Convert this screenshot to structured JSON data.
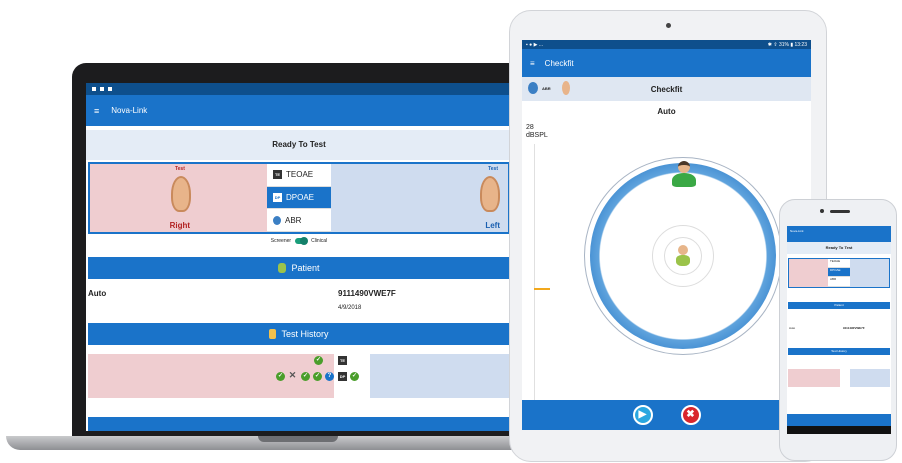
{
  "laptop": {
    "app_title": "Nova-Link",
    "menu_icon": "≡",
    "banner": "Ready To Test",
    "right_ear": {
      "test_label": "Test",
      "side_label": "Right"
    },
    "left_ear": {
      "test_label": "Test",
      "side_label": "Left"
    },
    "tests": [
      {
        "badge": "TE",
        "label": "TEOAE",
        "selected": false
      },
      {
        "badge": "DP",
        "label": "DPOAE",
        "selected": true
      },
      {
        "badge": "",
        "label": "ABR",
        "selected": false
      }
    ],
    "mode": {
      "left": "Screener",
      "right": "Clinical",
      "clinical_on": true
    },
    "patient_section": "Patient",
    "patient": {
      "name": "Auto",
      "id": "9111490VWE7F",
      "date": "4/9/2018"
    },
    "history_section": "Test History",
    "history_badges": [
      "TE",
      "DP"
    ]
  },
  "tablet": {
    "app_title": "Checkfit",
    "menu_icon": "≡",
    "status_right": "✱ ⇧ 31% ▮ 13:23",
    "header_abr": "ABR",
    "header_title": "Checkfit",
    "mode_label": "Auto",
    "level_value": "28",
    "level_unit": "dBSPL",
    "play_symbol": "▶",
    "stop_symbol": "✖"
  },
  "phone": {
    "app_title": "Nova-Link",
    "banner": "Ready To Test",
    "tests": [
      "TEOAE",
      "DPOAE",
      "ABR"
    ],
    "right_side": "Test Right",
    "left_side": "Test Left",
    "patient_section": "Patient",
    "patient_name": "Auto",
    "patient_id": "9111490VWE7F",
    "history_section": "Test History"
  },
  "colors": {
    "primary": "#1a73c9",
    "right_ear_bg": "#efcdd0",
    "left_ear_bg": "#cfdcef",
    "ok_green": "#4a9e2b",
    "stop_red": "#d9262c"
  }
}
